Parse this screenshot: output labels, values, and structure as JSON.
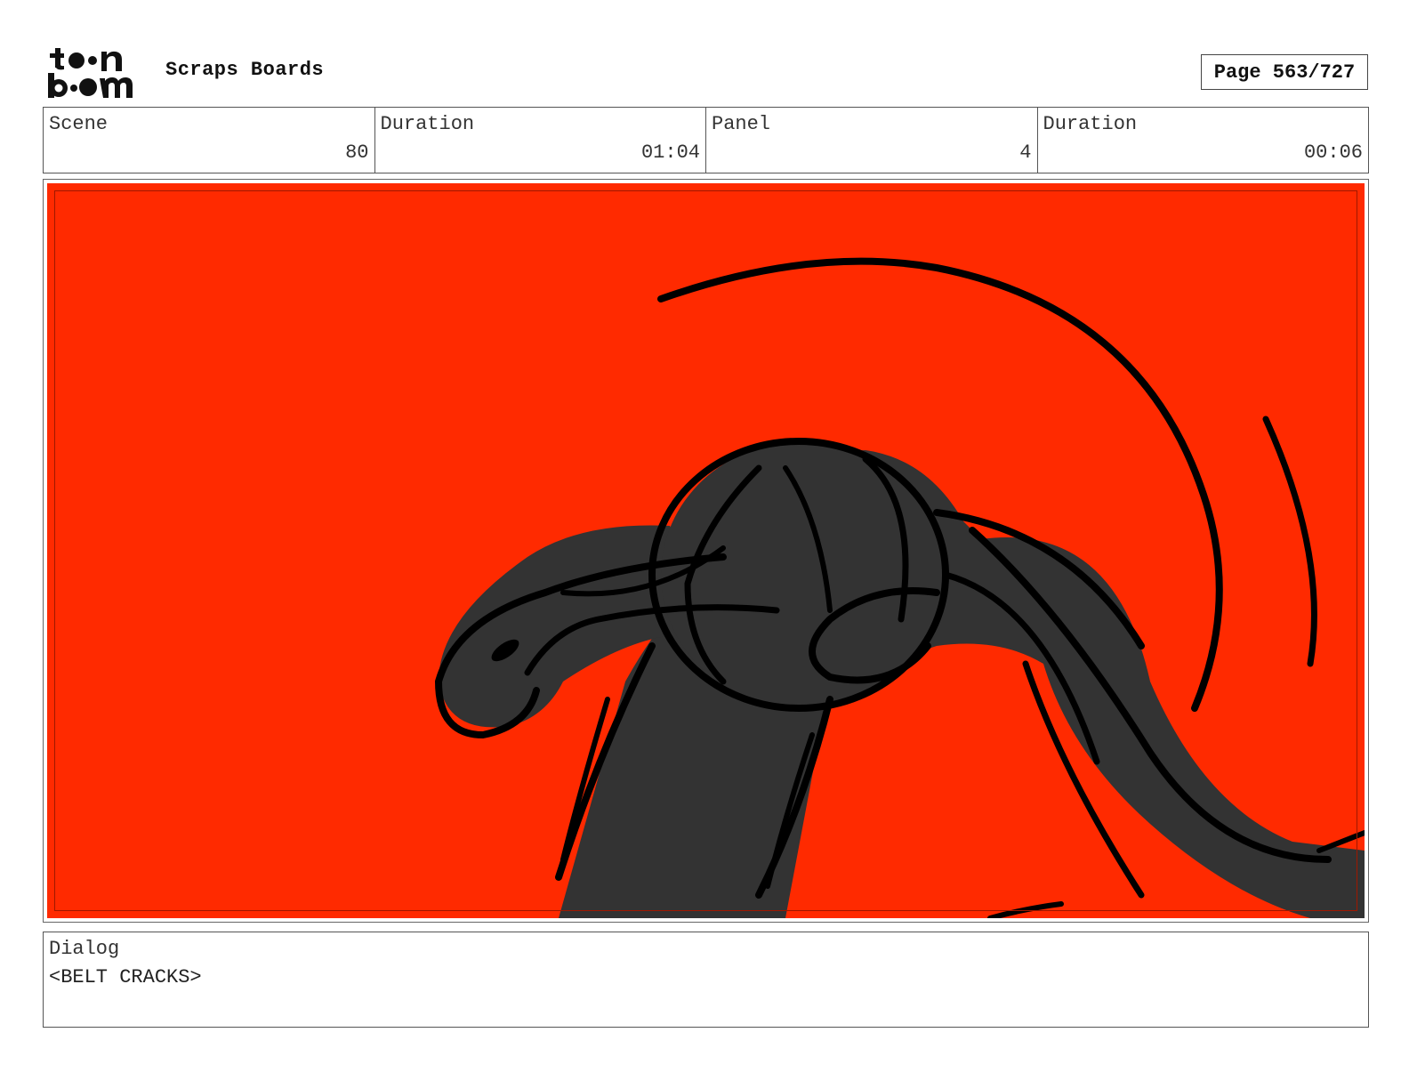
{
  "brand": {
    "logo_text": "toon boom",
    "logo_icon": "toon-boom-logo"
  },
  "header": {
    "title": "Scraps Boards",
    "page_label": "Page 563/727"
  },
  "info": {
    "scene_label": "Scene",
    "scene_value": "80",
    "scene_duration_label": "Duration",
    "scene_duration_value": "01:04",
    "panel_label": "Panel",
    "panel_value": "4",
    "panel_duration_label": "Duration",
    "panel_duration_value": "00:06"
  },
  "panel": {
    "background_color": "#ff2a00",
    "shape_color": "#333333",
    "line_color": "#000000"
  },
  "dialog": {
    "label": "Dialog",
    "text": "<BELT CRACKS>"
  }
}
